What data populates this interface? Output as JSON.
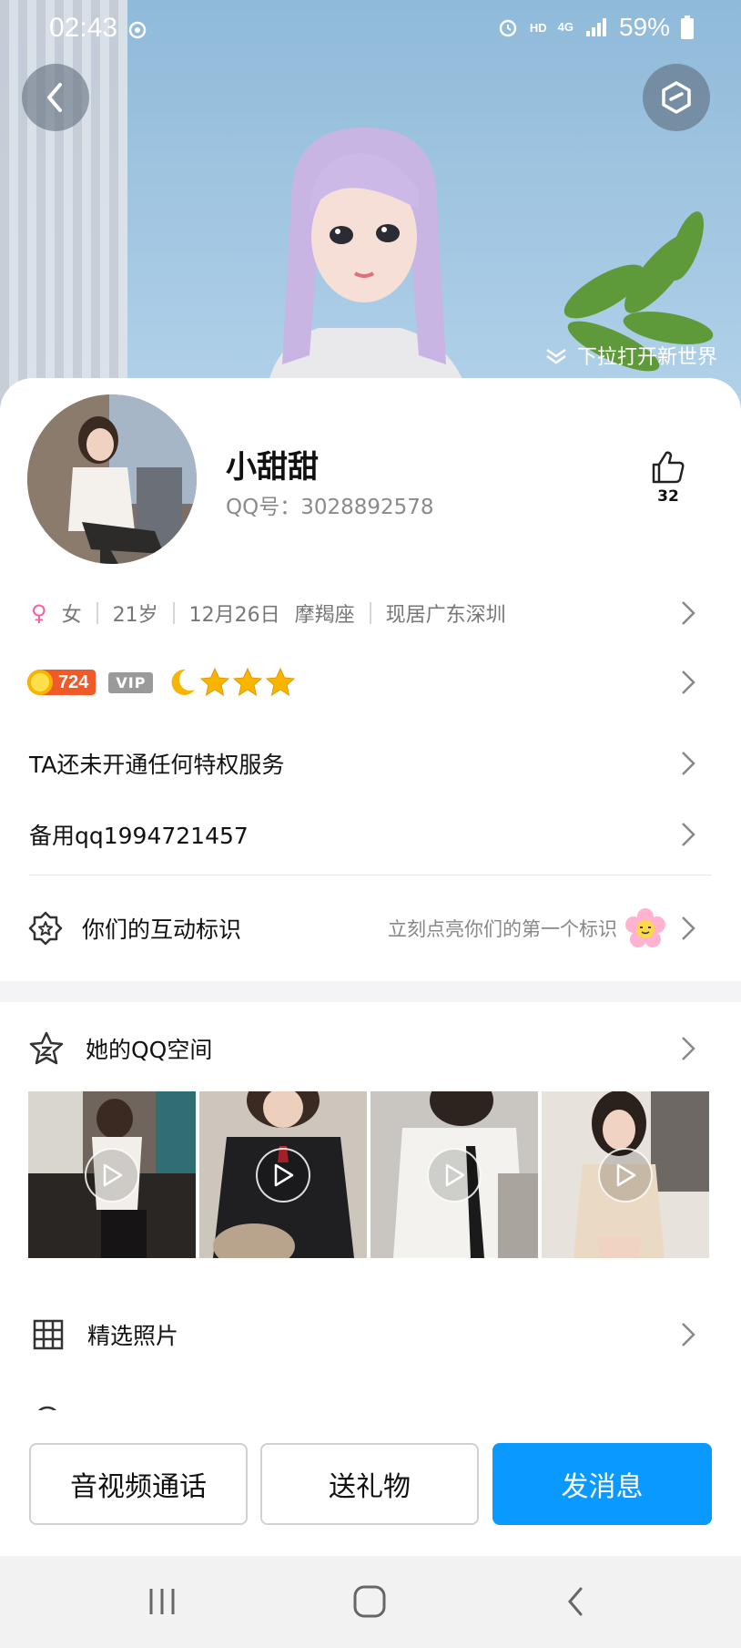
{
  "status_bar": {
    "time": "02:43",
    "hd": "HD",
    "network": "4G",
    "battery": "59%"
  },
  "header": {
    "pull_hint": "下拉打开新世界"
  },
  "profile": {
    "nickname": "小甜甜",
    "qq_label": "QQ号：3028892578",
    "like_count": "32",
    "gender": "女",
    "age": "21岁",
    "birthday": "12月26日",
    "zodiac": "摩羯座",
    "location": "现居广东深圳",
    "level_number": "724",
    "vip_label": "VIP",
    "star_count": 3
  },
  "rows": {
    "privilege": "TA还未开通任何特权服务",
    "backup": "备用qq1994721457",
    "interaction_label": "你们的互动标识",
    "interaction_hint": "立刻点亮你们的第一个标识"
  },
  "space": {
    "label": "她的QQ空间",
    "videos": [
      "video-1",
      "video-2",
      "video-3",
      "video-4"
    ]
  },
  "photos": {
    "label": "精选照片"
  },
  "actions": {
    "call": "音视频通话",
    "gift": "送礼物",
    "message": "发消息"
  },
  "colors": {
    "accent": "#0a99ff",
    "gender": "#ff5ea3",
    "level_badge": "#f05a28"
  }
}
